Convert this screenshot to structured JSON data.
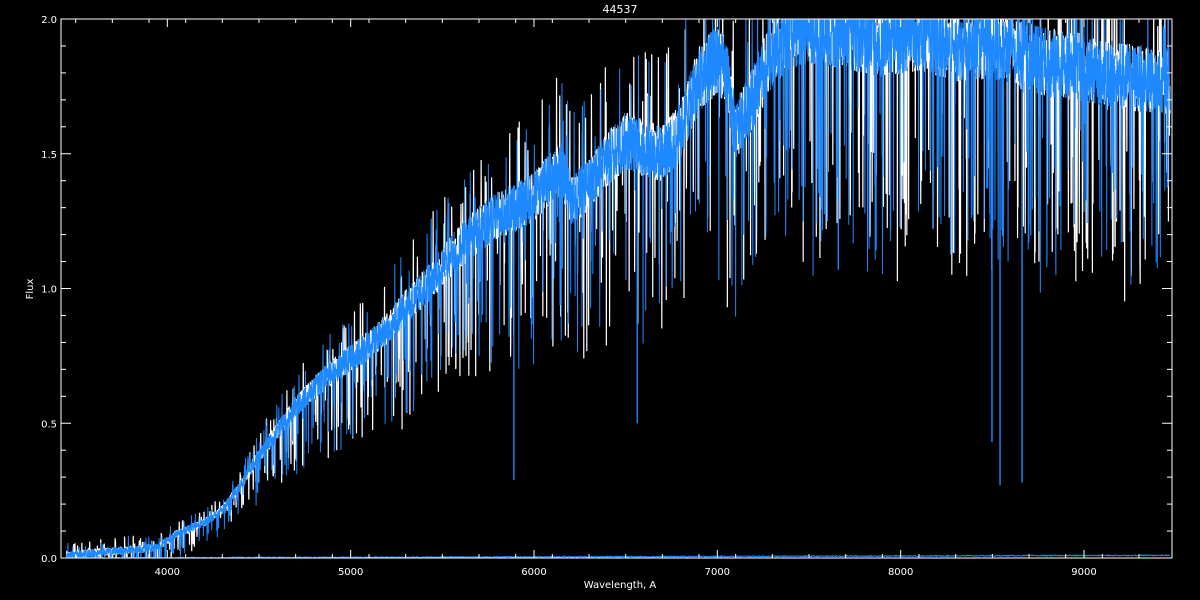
{
  "chart_data": {
    "type": "line",
    "title": "44537",
    "xlabel": "Wavelength, A",
    "ylabel": "Flux",
    "xlim": [
      3420,
      9480
    ],
    "ylim": [
      0.0,
      2.0
    ],
    "x_ticks": [
      4000,
      5000,
      6000,
      7000,
      8000,
      9000
    ],
    "x_tick_labels": [
      "4000",
      "5000",
      "6000",
      "7000",
      "8000",
      "9000"
    ],
    "y_ticks": [
      0.0,
      0.5,
      1.0,
      1.5,
      2.0
    ],
    "y_tick_labels": [
      "0.0",
      "0.5",
      "1.0",
      "1.5",
      "2.0"
    ],
    "grid": false,
    "background": "#000000",
    "axis_color": "#ffffff",
    "series": [
      {
        "color": "#ffffff",
        "x": [
          3450,
          3600,
          3800,
          3950,
          4050,
          4200,
          4300,
          4400,
          4500,
          4600,
          4700,
          4800,
          4900,
          5000,
          5100,
          5200,
          5300,
          5400,
          5500,
          5600,
          5700,
          5800,
          5900,
          6000,
          6100,
          6150,
          6200,
          6300,
          6400,
          6500,
          6600,
          6700,
          6800,
          6900,
          7000,
          7050,
          7100,
          7200,
          7300,
          7400,
          7500,
          7600,
          7700,
          7800,
          7900,
          8000,
          8100,
          8200,
          8300,
          8400,
          8500,
          8600,
          8700,
          8800,
          8900,
          9000,
          9100,
          9200,
          9300,
          9400,
          9470
        ],
        "values": [
          0.01,
          0.02,
          0.03,
          0.04,
          0.09,
          0.13,
          0.18,
          0.27,
          0.38,
          0.47,
          0.56,
          0.63,
          0.69,
          0.74,
          0.79,
          0.85,
          0.93,
          1.0,
          1.08,
          1.16,
          1.22,
          1.27,
          1.3,
          1.34,
          1.42,
          1.45,
          1.33,
          1.38,
          1.48,
          1.55,
          1.52,
          1.5,
          1.58,
          1.78,
          1.85,
          1.8,
          1.58,
          1.72,
          1.88,
          1.95,
          1.97,
          1.96,
          1.95,
          1.93,
          1.92,
          1.93,
          1.94,
          1.92,
          1.9,
          1.91,
          1.9,
          1.88,
          1.86,
          1.84,
          1.83,
          1.82,
          1.8,
          1.79,
          1.78,
          1.77,
          1.77
        ]
      },
      {
        "color": "#1e88ff",
        "x": [
          3450,
          3600,
          3800,
          3950,
          4050,
          4200,
          4300,
          4400,
          4500,
          4600,
          4700,
          4800,
          4900,
          5000,
          5100,
          5200,
          5300,
          5400,
          5500,
          5600,
          5700,
          5800,
          5900,
          6000,
          6100,
          6150,
          6200,
          6300,
          6400,
          6500,
          6600,
          6700,
          6800,
          6900,
          7000,
          7050,
          7100,
          7200,
          7300,
          7400,
          7500,
          7600,
          7700,
          7800,
          7900,
          8000,
          8100,
          8200,
          8300,
          8400,
          8500,
          8600,
          8700,
          8800,
          8900,
          9000,
          9100,
          9200,
          9300,
          9400,
          9470
        ],
        "values": [
          0.01,
          0.02,
          0.03,
          0.04,
          0.09,
          0.13,
          0.18,
          0.27,
          0.38,
          0.47,
          0.56,
          0.63,
          0.69,
          0.74,
          0.79,
          0.85,
          0.93,
          1.0,
          1.08,
          1.16,
          1.22,
          1.27,
          1.3,
          1.34,
          1.42,
          1.45,
          1.33,
          1.38,
          1.48,
          1.55,
          1.52,
          1.5,
          1.58,
          1.78,
          1.85,
          1.8,
          1.58,
          1.72,
          1.88,
          1.95,
          1.97,
          1.96,
          1.95,
          1.93,
          1.92,
          1.93,
          1.94,
          1.92,
          1.9,
          1.91,
          1.9,
          1.88,
          1.86,
          1.84,
          1.83,
          1.82,
          1.8,
          1.79,
          1.78,
          1.77,
          1.77
        ]
      },
      {
        "color": "#1e88ff",
        "x": [
          3450,
          9470
        ],
        "values": [
          0.0,
          0.01
        ]
      }
    ],
    "absorption_lines": [
      {
        "x": 5890,
        "depth_to": 0.29
      },
      {
        "x": 6563,
        "depth_to": 0.5
      },
      {
        "x": 7660,
        "depth_to": 1.07
      },
      {
        "x": 8498,
        "depth_to": 0.43
      },
      {
        "x": 8542,
        "depth_to": 0.27
      },
      {
        "x": 8662,
        "depth_to": 0.28
      },
      {
        "x": 7600,
        "depth_to": 1.25
      },
      {
        "x": 8200,
        "depth_to": 1.45
      },
      {
        "x": 9250,
        "depth_to": 1.35
      }
    ]
  }
}
